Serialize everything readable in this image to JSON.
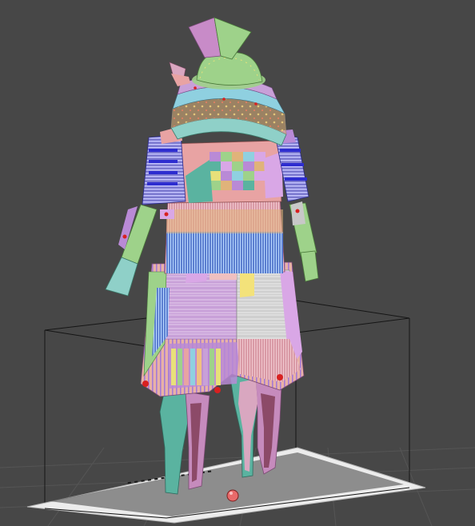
{
  "viewport": {
    "background_color": "#474747",
    "grid_color": "#5a5a5a",
    "floor_color": "#e9e9e9",
    "bounding_box_color": "#111111",
    "gizmo_color": "#e85a5a"
  },
  "model": {
    "type": "samurai-armor",
    "display_mode": "polygroups",
    "palette": [
      "#d9a7e6",
      "#9ed28a",
      "#e8a3a3",
      "#b98ad6",
      "#5ab3a0",
      "#3a3ad8",
      "#e0b37a",
      "#8fd0e0",
      "#c8c8c8",
      "#d64a4a"
    ]
  }
}
